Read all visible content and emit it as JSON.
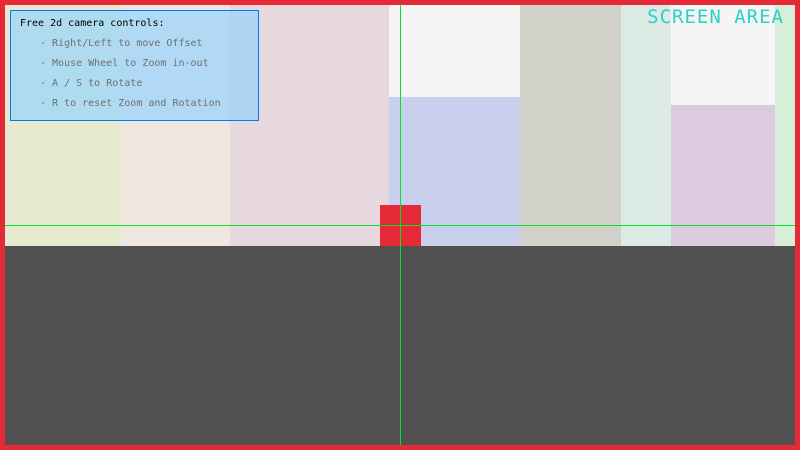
{
  "window": {
    "screen_area_label": "SCREEN AREA"
  },
  "help": {
    "title": "Free 2d camera controls:",
    "lines": [
      "- Right/Left to move Offset",
      "- Mouse Wheel to Zoom in-out",
      "- A / S to Rotate",
      "- R to reset Zoom and Rotation"
    ]
  },
  "colors": {
    "frame": "#e62937",
    "player": "#e62937",
    "crosshair": "#00e430",
    "ground": "#505050",
    "screen_area_text": "#2ad1c8",
    "panel_border": "#0079f1"
  }
}
